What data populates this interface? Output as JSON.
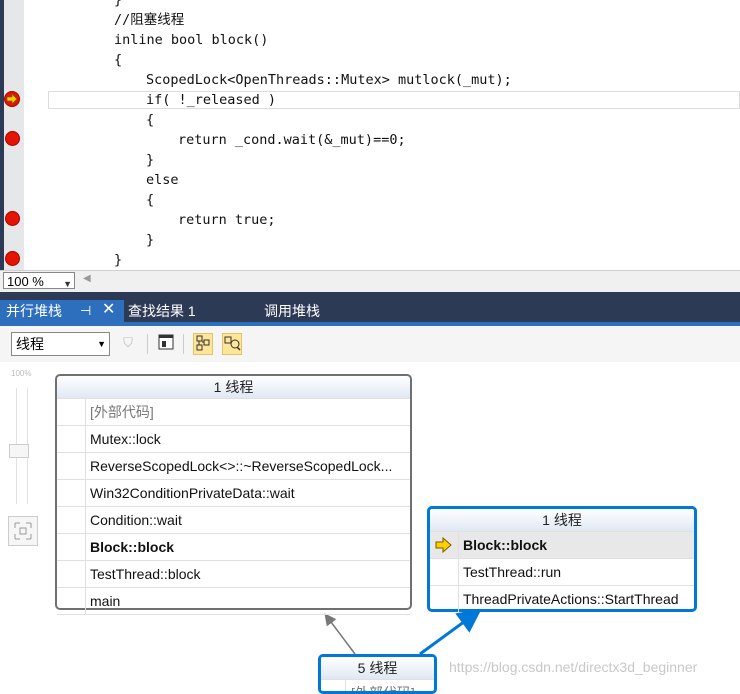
{
  "code": {
    "lines": [
      "}",
      "//阻塞线程",
      "inline bool block()",
      "{",
      "ScopedLock<OpenThreads::Mutex> mutlock(_mut);",
      "if( !_released )",
      "{",
      "return _cond.wait(&_mut)==0;",
      "}",
      "else",
      "{",
      "return true;",
      "}",
      "}"
    ]
  },
  "status": {
    "zoom": "100 %"
  },
  "tabs": [
    {
      "label": "并行堆栈",
      "active": true
    },
    {
      "label": "查找结果 1",
      "active": false
    },
    {
      "label": "调用堆栈",
      "active": false
    }
  ],
  "toolbar": {
    "thread_selector": "线程"
  },
  "zoom_slider": {
    "label": "100%"
  },
  "nodes": [
    {
      "title": "1 线程",
      "frames": [
        "[外部代码]",
        "Mutex::lock",
        "ReverseScopedLock<>::~ReverseScopedLock...",
        "Win32ConditionPrivateData::wait",
        "Condition::wait",
        "Block::block",
        "TestThread::block",
        "main"
      ]
    },
    {
      "title": "1 线程",
      "frames": [
        "Block::block",
        "TestThread::run",
        "ThreadPrivateActions::StartThread"
      ]
    },
    {
      "title": "5 线程",
      "frames": [
        "[外部代码]"
      ]
    }
  ],
  "watermark": "https://blog.csdn.net/directx3d_beginner",
  "colors": {
    "accent": "#0078d7",
    "tab_active": "#2e6fbd",
    "tab_bar": "#2d3a55",
    "breakpoint": "#e51400"
  }
}
